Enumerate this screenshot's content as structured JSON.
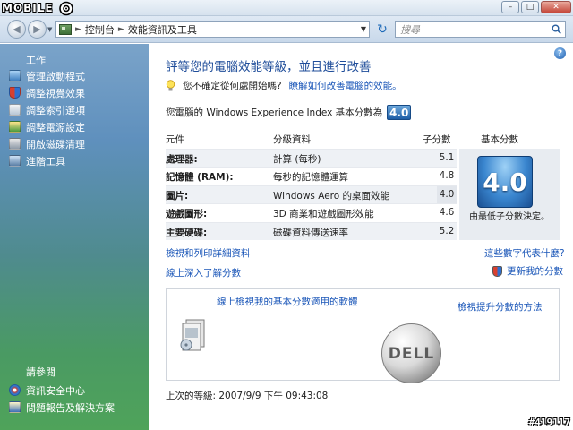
{
  "logo": {
    "text": "MOBILE"
  },
  "nav": {
    "crumbs": [
      "控制台",
      "效能資訊及工具"
    ],
    "search_placeholder": "搜尋"
  },
  "sidebar": {
    "tasks_heading": "工作",
    "tasks": [
      {
        "label": "管理啟動程式",
        "icon": "startup-icon"
      },
      {
        "label": "調整視覺效果",
        "icon": "shield-icon"
      },
      {
        "label": "調整索引選項",
        "icon": "index-icon"
      },
      {
        "label": "調整電源設定",
        "icon": "power-icon"
      },
      {
        "label": "開啟磁碟清理",
        "icon": "disk-cleanup-icon"
      },
      {
        "label": "進階工具",
        "icon": "tools-icon"
      }
    ],
    "see_also_heading": "請參閱",
    "see_also": [
      {
        "label": "資訊安全中心",
        "icon": "security-center-icon"
      },
      {
        "label": "問題報告及解決方案",
        "icon": "problem-report-icon"
      }
    ]
  },
  "main": {
    "title": "評等您的電腦效能等級，並且進行改善",
    "tip_text": "您不確定從何處開始嗎?",
    "tip_link": "瞭解如何改善電腦的效能。",
    "base_score_text": "您電腦的 Windows Experience Index 基本分數為",
    "base_score": "4.0",
    "table": {
      "headers": {
        "component": "元件",
        "rated": "分級資料",
        "subscore": "子分數",
        "base": "基本分數"
      },
      "rows": [
        {
          "component": "處理器:",
          "desc": "計算 (每秒)",
          "score": "5.1"
        },
        {
          "component": "記憶體 (RAM):",
          "desc": "每秒的記憶體運算",
          "score": "4.8"
        },
        {
          "component": "圖片:",
          "desc": "Windows Aero 的桌面效能",
          "score": "4.0"
        },
        {
          "component": "遊戲圖形:",
          "desc": "3D 商業和遊戲圖形效能",
          "score": "4.6"
        },
        {
          "component": "主要硬碟:",
          "desc": "磁碟資料傳送速率",
          "score": "5.2"
        }
      ]
    },
    "base_caption": "由最低子分數決定。",
    "link_print": "檢視和列印詳細資料",
    "link_meaning": "這些數字代表什麼?",
    "link_learn": "線上深入了解分數",
    "link_refresh": "更新我的分數",
    "promo_link1": "線上檢視我的基本分數適用的軟體",
    "promo_link2": "檢視提升分數的方法",
    "promo_logo_text": "DELL",
    "last_rated": "上次的等級: 2007/9/9 下午 09:43:08"
  },
  "watermark": "#419117"
}
